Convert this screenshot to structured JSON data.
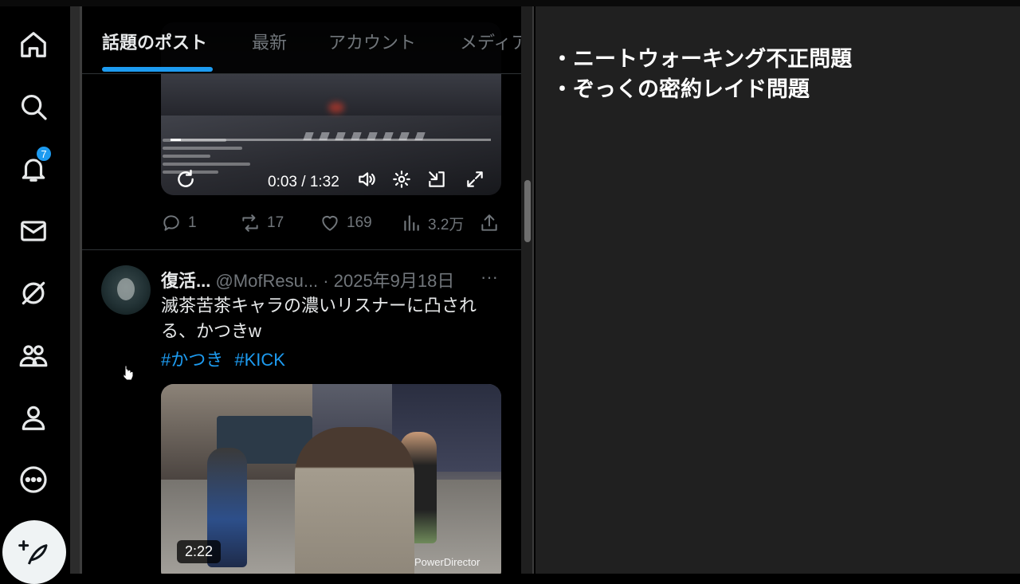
{
  "nav": {
    "notification_count": "7",
    "items": [
      "home",
      "explore",
      "notifications",
      "messages",
      "grok",
      "communities",
      "profile",
      "more"
    ]
  },
  "tabs": [
    {
      "label": "話題のポスト",
      "active": true
    },
    {
      "label": "最新",
      "active": false
    },
    {
      "label": "アカウント",
      "active": false
    },
    {
      "label": "メディア",
      "active": false
    }
  ],
  "post1": {
    "video": {
      "time": "0:03 / 1:32",
      "progress": 0.033
    },
    "replies": "1",
    "reposts": "17",
    "likes": "169",
    "views": "3.2万"
  },
  "post2": {
    "name": "復活...",
    "handle": "@MofResu...",
    "date": "· 2025年9月18日",
    "more": "···",
    "text": "滅茶苦茶キャラの濃いリスナーに凸される、かつきw",
    "hashtags": [
      "#かつき",
      "#KICK"
    ],
    "video": {
      "duration": "2:22",
      "watermark": "PowerDirector"
    }
  },
  "notes": {
    "lines": [
      "・ニートウォーキング不正問題",
      "・ぞっくの密約レイド問題"
    ]
  },
  "colors": {
    "accent": "#1d9bf0",
    "background": "#000000",
    "notes_bg": "#202020"
  }
}
